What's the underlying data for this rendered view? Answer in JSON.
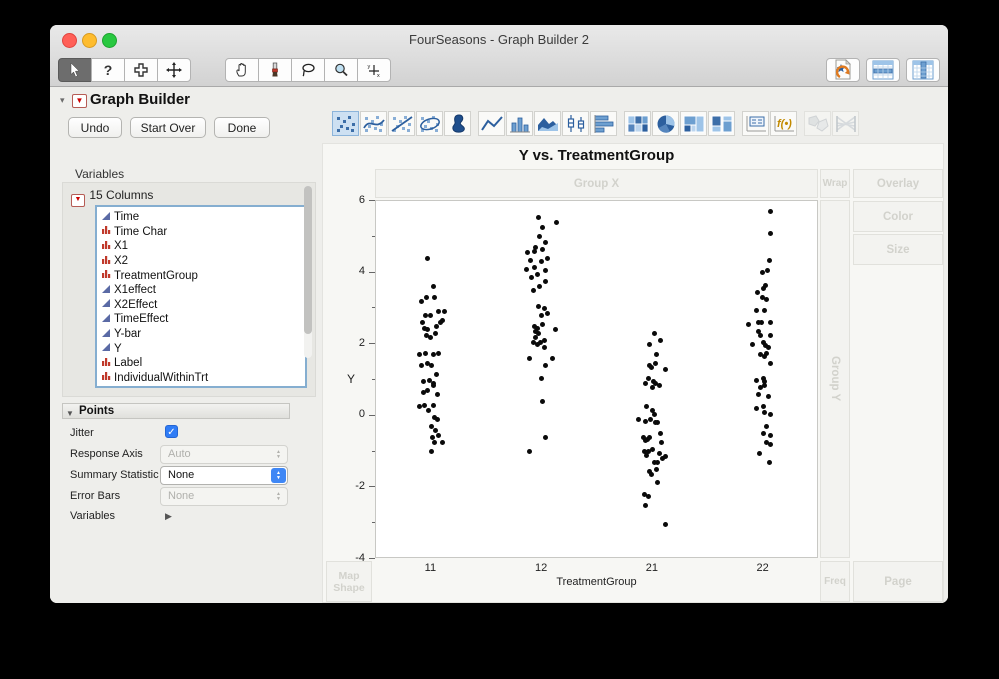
{
  "window": {
    "title": "FourSeasons - Graph Builder 2"
  },
  "toolbar": {
    "left_tools": [
      "arrow",
      "help",
      "fat-plus",
      "move"
    ],
    "mid_tools": [
      "grabber-hand",
      "brush",
      "lasso",
      "magnifier",
      "crosshair"
    ],
    "right_tools": [
      "recall-script",
      "data-table-row",
      "data-table-column"
    ],
    "selected_tool": "arrow"
  },
  "graph_builder": {
    "title": "Graph Builder",
    "buttons": {
      "undo": "Undo",
      "start_over": "Start Over",
      "done": "Done"
    }
  },
  "palette": {
    "items": [
      "points",
      "smoother",
      "line-of-fit",
      "ellipse",
      "contour",
      "line",
      "bar",
      "area",
      "box-plot",
      "histogram",
      "heatmap",
      "pie",
      "treemap",
      "mosaic",
      "caption-box",
      "formula",
      "map-shapes",
      "parallel-plot"
    ],
    "selected": "points",
    "disabled": [
      "map-shapes",
      "parallel-plot"
    ]
  },
  "variables": {
    "label": "Variables",
    "header": "15 Columns",
    "items": [
      {
        "name": "Time",
        "type": "continuous"
      },
      {
        "name": "Time Char",
        "type": "nominal"
      },
      {
        "name": "X1",
        "type": "nominal"
      },
      {
        "name": "X2",
        "type": "nominal"
      },
      {
        "name": "TreatmentGroup",
        "type": "nominal"
      },
      {
        "name": "X1effect",
        "type": "continuous"
      },
      {
        "name": "X2Effect",
        "type": "continuous"
      },
      {
        "name": "TimeEffect",
        "type": "continuous"
      },
      {
        "name": "Y-bar",
        "type": "continuous"
      },
      {
        "name": "Y",
        "type": "continuous"
      },
      {
        "name": "Label",
        "type": "nominal"
      },
      {
        "name": "IndividualWithinTrt",
        "type": "nominal"
      }
    ]
  },
  "points_panel": {
    "title": "Points",
    "jitter_label": "Jitter",
    "jitter_checked": true,
    "response_axis_label": "Response Axis",
    "response_axis_value": "Auto",
    "summary_statistic_label": "Summary Statistic",
    "summary_statistic_value": "None",
    "error_bars_label": "Error Bars",
    "error_bars_value": "None",
    "variables_label": "Variables"
  },
  "zones": {
    "group_x": "Group X",
    "wrap": "Wrap",
    "overlay": "Overlay",
    "color": "Color",
    "size": "Size",
    "group_y": "Group Y",
    "map_shape": "Map Shape",
    "freq": "Freq",
    "page": "Page"
  },
  "colors": {
    "accent_blue": "#3f87f5",
    "point_color": "#0a0a0a",
    "traffic_red": "#ff5f57",
    "traffic_yellow": "#febc2e",
    "traffic_green": "#28c840"
  },
  "chart_data": {
    "type": "scatter",
    "title": "Y vs. TreatmentGroup",
    "xlabel": "TreatmentGroup",
    "ylabel": "Y",
    "categories": [
      "11",
      "12",
      "21",
      "22"
    ],
    "ylim": [
      -4,
      6
    ],
    "yticks": [
      6,
      4,
      2,
      0,
      -2,
      -4
    ],
    "grid": false,
    "jitter": true,
    "legend": "none",
    "series": [
      {
        "name": "11",
        "points": [
          [
            -4,
            4.4
          ],
          [
            2,
            3.6
          ],
          [
            -10,
            3.2
          ],
          [
            -5,
            3.3
          ],
          [
            3,
            3.3
          ],
          [
            7,
            2.9
          ],
          [
            13,
            2.9
          ],
          [
            -6,
            2.8
          ],
          [
            -1,
            2.8
          ],
          [
            -9,
            2.6
          ],
          [
            9,
            2.6
          ],
          [
            11,
            2.65
          ],
          [
            -7,
            2.45
          ],
          [
            -4,
            2.4
          ],
          [
            5,
            2.5
          ],
          [
            -5,
            2.25
          ],
          [
            -1,
            2.2
          ],
          [
            4,
            2.3
          ],
          [
            -12,
            1.7
          ],
          [
            -6,
            1.75
          ],
          [
            2,
            1.7
          ],
          [
            7,
            1.75
          ],
          [
            -10,
            1.4
          ],
          [
            -4,
            1.45
          ],
          [
            0,
            1.4
          ],
          [
            5,
            1.15
          ],
          [
            -8,
            0.95
          ],
          [
            -2,
            1.0
          ],
          [
            2,
            0.9
          ],
          [
            -8,
            0.65
          ],
          [
            -4,
            0.7
          ],
          [
            2,
            0.85
          ],
          [
            6,
            0.6
          ],
          [
            -12,
            0.25
          ],
          [
            -7,
            0.3
          ],
          [
            2,
            0.3
          ],
          [
            -3,
            0.15
          ],
          [
            3,
            -0.05
          ],
          [
            6,
            -0.1
          ],
          [
            0,
            -0.3
          ],
          [
            4,
            -0.4
          ],
          [
            1,
            -0.6
          ],
          [
            7,
            -0.55
          ],
          [
            3,
            -0.75
          ],
          [
            11,
            -0.75
          ],
          [
            0,
            -1.0
          ]
        ]
      },
      {
        "name": "12",
        "points": [
          [
            -4,
            5.55
          ],
          [
            14,
            5.4
          ],
          [
            0,
            5.25
          ],
          [
            -3,
            5.0
          ],
          [
            3,
            4.85
          ],
          [
            -7,
            4.7
          ],
          [
            0,
            4.65
          ],
          [
            -15,
            4.55
          ],
          [
            -8,
            4.6
          ],
          [
            -12,
            4.35
          ],
          [
            -1,
            4.3
          ],
          [
            5,
            4.4
          ],
          [
            -16,
            4.1
          ],
          [
            -8,
            4.15
          ],
          [
            3,
            4.05
          ],
          [
            -11,
            3.85
          ],
          [
            -5,
            3.95
          ],
          [
            3,
            3.75
          ],
          [
            -9,
            3.5
          ],
          [
            -3,
            3.6
          ],
          [
            -4,
            3.05
          ],
          [
            2,
            3.0
          ],
          [
            -1,
            2.8
          ],
          [
            5,
            2.85
          ],
          [
            -8,
            2.5
          ],
          [
            -5,
            2.45
          ],
          [
            0,
            2.55
          ],
          [
            13,
            2.4
          ],
          [
            -7,
            2.35
          ],
          [
            -4,
            2.3
          ],
          [
            -7,
            2.2
          ],
          [
            -9,
            2.05
          ],
          [
            -5,
            2.0
          ],
          [
            -2,
            2.05
          ],
          [
            2,
            2.1
          ],
          [
            2,
            1.9
          ],
          [
            -13,
            1.6
          ],
          [
            10,
            1.6
          ],
          [
            3,
            1.4
          ],
          [
            -1,
            1.05
          ],
          [
            0,
            0.4
          ],
          [
            3,
            -0.6
          ],
          [
            -13,
            -1.0
          ]
        ]
      },
      {
        "name": "21",
        "points": [
          [
            2,
            2.3
          ],
          [
            -3,
            2.0
          ],
          [
            8,
            2.1
          ],
          [
            4,
            1.7
          ],
          [
            3,
            1.45
          ],
          [
            -3,
            1.4
          ],
          [
            -1,
            1.35
          ],
          [
            13,
            1.3
          ],
          [
            -4,
            1.05
          ],
          [
            1,
            0.95
          ],
          [
            -7,
            0.9
          ],
          [
            3,
            0.9
          ],
          [
            7,
            0.85
          ],
          [
            0,
            0.8
          ],
          [
            -6,
            0.25
          ],
          [
            0,
            0.15
          ],
          [
            2,
            0.05
          ],
          [
            -14,
            -0.1
          ],
          [
            -7,
            -0.15
          ],
          [
            -2,
            -0.1
          ],
          [
            3,
            -0.2
          ],
          [
            5,
            -0.2
          ],
          [
            -9,
            -0.6
          ],
          [
            -5,
            -0.65
          ],
          [
            -7,
            -0.7
          ],
          [
            -3,
            -0.6
          ],
          [
            8,
            -0.5
          ],
          [
            9,
            -0.75
          ],
          [
            -8,
            -1.0
          ],
          [
            -4,
            -1.0
          ],
          [
            0,
            -0.95
          ],
          [
            7,
            -1.05
          ],
          [
            13,
            -1.15
          ],
          [
            10,
            -1.2
          ],
          [
            -6,
            -1.1
          ],
          [
            2,
            -1.3
          ],
          [
            5,
            -1.3
          ],
          [
            -3,
            -1.55
          ],
          [
            4,
            -1.5
          ],
          [
            -1,
            -1.65
          ],
          [
            5,
            -1.85
          ],
          [
            -8,
            -2.2
          ],
          [
            -4,
            -2.25
          ],
          [
            -7,
            -2.5
          ],
          [
            13,
            -3.05
          ]
        ]
      },
      {
        "name": "22",
        "points": [
          [
            7,
            5.7
          ],
          [
            7,
            5.1
          ],
          [
            6,
            4.35
          ],
          [
            4,
            4.05
          ],
          [
            -1,
            4.0
          ],
          [
            2,
            3.65
          ],
          [
            0,
            3.55
          ],
          [
            -6,
            3.45
          ],
          [
            3,
            3.25
          ],
          [
            -1,
            3.3
          ],
          [
            -7,
            2.95
          ],
          [
            1,
            2.95
          ],
          [
            -15,
            2.55
          ],
          [
            -5,
            2.6
          ],
          [
            -2,
            2.6
          ],
          [
            7,
            2.6
          ],
          [
            -5,
            2.35
          ],
          [
            -3,
            2.25
          ],
          [
            7,
            2.25
          ],
          [
            -11,
            2.0
          ],
          [
            0,
            2.05
          ],
          [
            2,
            1.95
          ],
          [
            5,
            1.9
          ],
          [
            -3,
            1.7
          ],
          [
            1,
            1.65
          ],
          [
            3,
            1.75
          ],
          [
            7,
            1.45
          ],
          [
            -7,
            1.0
          ],
          [
            0,
            1.05
          ],
          [
            1,
            0.95
          ],
          [
            -3,
            0.8
          ],
          [
            1,
            0.85
          ],
          [
            -5,
            0.6
          ],
          [
            5,
            0.55
          ],
          [
            -7,
            0.2
          ],
          [
            0,
            0.25
          ],
          [
            1,
            0.1
          ],
          [
            7,
            0.05
          ],
          [
            3,
            -0.3
          ],
          [
            0,
            -0.5
          ],
          [
            7,
            -0.55
          ],
          [
            3,
            -0.75
          ],
          [
            7,
            -0.8
          ],
          [
            -4,
            -1.05
          ],
          [
            6,
            -1.3
          ]
        ]
      }
    ]
  }
}
